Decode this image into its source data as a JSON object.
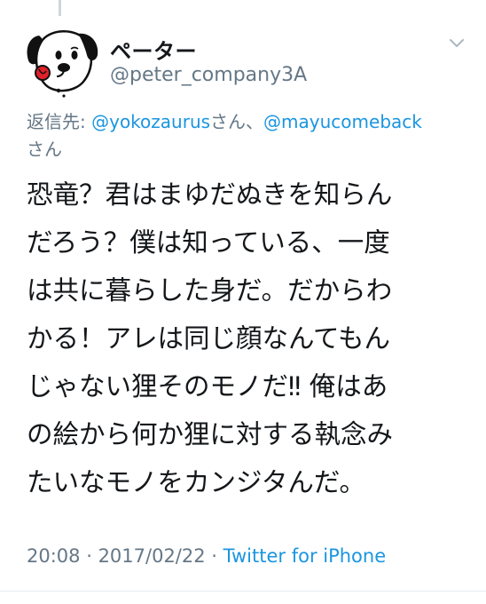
{
  "author": {
    "display_name": "ペーター",
    "handle": "@peter_company3A",
    "avatar_icon": "dog-avatar-icon"
  },
  "menu": {
    "caret_icon": "chevron-down-icon"
  },
  "reply_context": {
    "prefix": "返信先: ",
    "mention_1": "@yokozaurus",
    "san_1": "さん、",
    "mention_2": "@mayucomeback",
    "san_2": "さん"
  },
  "tweet": {
    "lines": [
      "恐竜？君はまゆだぬきを知らん",
      "だろう？僕は知っている、一度",
      "は共に暮らした身だ。だからわ",
      "かる！アレは同じ顔なんてもん",
      "じゃない狸そのモノだ‼︎ 俺はあ",
      "の絵から何か狸に対する執念み",
      "たいなモノをカンジタんだ。"
    ]
  },
  "meta": {
    "time": "20:08",
    "separator_1": " · ",
    "date": "2017/02/22",
    "separator_2": " · ",
    "source": "Twitter for iPhone"
  },
  "colors": {
    "link_blue": "#1b95e0",
    "secondary_gray": "#657786",
    "text_dark": "#14171a",
    "divider": "#e6ecf0"
  }
}
